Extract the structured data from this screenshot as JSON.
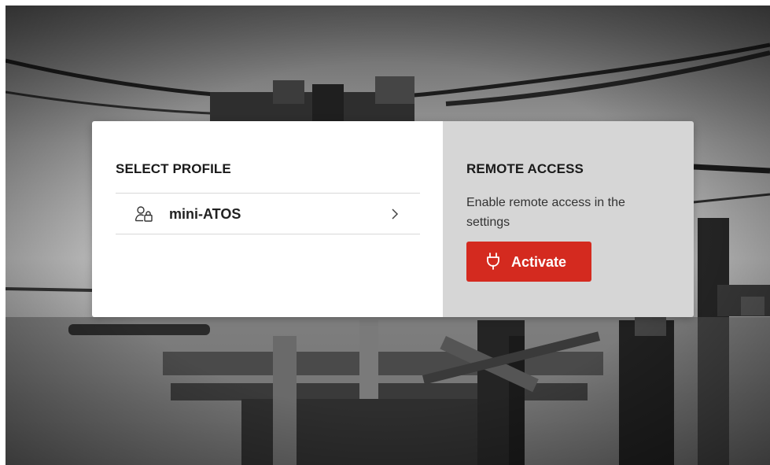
{
  "profiles": {
    "title": "SELECT PROFILE",
    "items": [
      {
        "name": "mini-ATOS",
        "icon": "user-lock-icon"
      }
    ]
  },
  "remote": {
    "title": "REMOTE ACCESS",
    "description": "Enable remote access in the settings",
    "button_label": "Activate",
    "button_icon": "plug-icon"
  },
  "colors": {
    "accent": "#d42a1f",
    "right_panel": "#d6d6d6",
    "left_panel": "#ffffff"
  }
}
